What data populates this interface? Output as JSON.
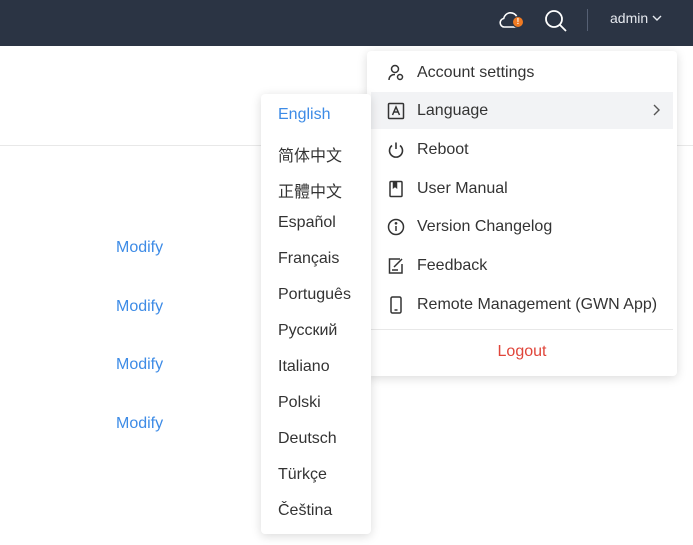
{
  "header": {
    "cloud_icon": "cloud-icon",
    "cloud_badge": "!",
    "search_icon": "search-icon",
    "user": "admin"
  },
  "page": {
    "modify_links": [
      "Modify",
      "Modify",
      "Modify",
      "Modify"
    ]
  },
  "language_menu": {
    "items": [
      "English",
      "简体中文",
      "正體中文",
      "Español",
      "Français",
      "Português",
      "Русский",
      "Italiano",
      "Polski",
      "Deutsch",
      "Türkçe",
      "Čeština"
    ],
    "selected": "English"
  },
  "account_menu": {
    "items": [
      {
        "label": "Account settings",
        "icon": "user-gear-icon"
      },
      {
        "label": "Language",
        "icon": "language-icon"
      },
      {
        "label": "Reboot",
        "icon": "power-icon"
      },
      {
        "label": "User Manual",
        "icon": "book-icon"
      },
      {
        "label": "Version Changelog",
        "icon": "info-icon"
      },
      {
        "label": "Feedback",
        "icon": "feedback-icon"
      },
      {
        "label": "Remote Management (GWN App)",
        "icon": "mobile-icon"
      }
    ],
    "logout": "Logout"
  },
  "colors": {
    "header_bg": "#2b3444",
    "link": "#3d8be6",
    "logout": "#e0453a",
    "badge": "#f07a22"
  }
}
